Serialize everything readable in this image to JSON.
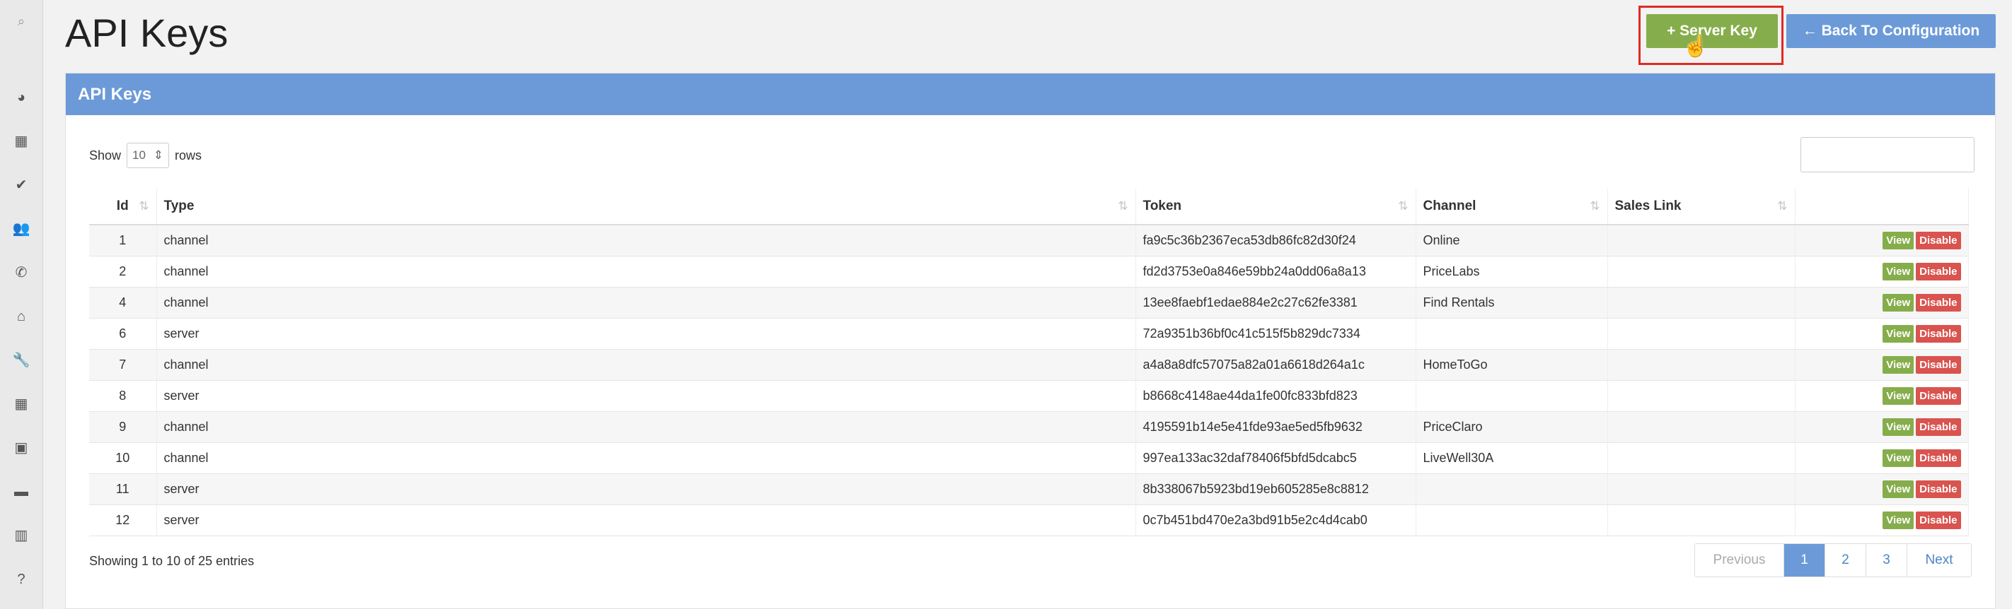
{
  "sidebar": {
    "icons": [
      {
        "name": "search-icon",
        "glyph": "⌕"
      },
      {
        "name": "dashboard-icon",
        "glyph": "◕"
      },
      {
        "name": "calendar-icon",
        "glyph": "▦"
      },
      {
        "name": "check-circle-icon",
        "glyph": "✔"
      },
      {
        "name": "users-icon",
        "glyph": "👥"
      },
      {
        "name": "phone-icon",
        "glyph": "✆"
      },
      {
        "name": "home-icon",
        "glyph": "⌂"
      },
      {
        "name": "wrench-icon",
        "glyph": "🔧"
      },
      {
        "name": "grid-icon",
        "glyph": "▦"
      },
      {
        "name": "money-icon",
        "glyph": "▣"
      },
      {
        "name": "briefcase-icon",
        "glyph": "▬"
      },
      {
        "name": "bar-chart-icon",
        "glyph": "▥"
      },
      {
        "name": "help-icon",
        "glyph": "?"
      }
    ]
  },
  "header": {
    "title": "API Keys",
    "server_key_label": "+ Server Key",
    "back_label": "← Back To Configuration"
  },
  "panel": {
    "heading": "API Keys",
    "show_label": "Show",
    "rows_value": "10",
    "rows_label": "rows",
    "search_value": ""
  },
  "table": {
    "columns": [
      "Id",
      "Type",
      "Token",
      "Channel",
      "Sales Link",
      ""
    ],
    "rows": [
      {
        "id": "1",
        "type": "channel",
        "token": "fa9c5c36b2367eca53db86fc82d30f24",
        "channel": "Online",
        "sales_link": ""
      },
      {
        "id": "2",
        "type": "channel",
        "token": "fd2d3753e0a846e59bb24a0dd06a8a13",
        "channel": "PriceLabs",
        "sales_link": ""
      },
      {
        "id": "4",
        "type": "channel",
        "token": "13ee8faebf1edae884e2c27c62fe3381",
        "channel": "Find Rentals",
        "sales_link": ""
      },
      {
        "id": "6",
        "type": "server",
        "token": "72a9351b36bf0c41c515f5b829dc7334",
        "channel": "",
        "sales_link": ""
      },
      {
        "id": "7",
        "type": "channel",
        "token": "a4a8a8dfc57075a82a01a6618d264a1c",
        "channel": "HomeToGo",
        "sales_link": ""
      },
      {
        "id": "8",
        "type": "server",
        "token": "b8668c4148ae44da1fe00fc833bfd823",
        "channel": "",
        "sales_link": ""
      },
      {
        "id": "9",
        "type": "channel",
        "token": "4195591b14e5e41fde93ae5ed5fb9632",
        "channel": "PriceClaro",
        "sales_link": ""
      },
      {
        "id": "10",
        "type": "channel",
        "token": "997ea133ac32daf78406f5bfd5dcabc5",
        "channel": "LiveWell30A",
        "sales_link": ""
      },
      {
        "id": "11",
        "type": "server",
        "token": "8b338067b5923bd19eb605285e8c8812",
        "channel": "",
        "sales_link": ""
      },
      {
        "id": "12",
        "type": "server",
        "token": "0c7b451bd470e2a3bd91b5e2c4d4cab0",
        "channel": "",
        "sales_link": ""
      }
    ],
    "view_label": "View",
    "disable_label": "Disable"
  },
  "footer": {
    "info": "Showing 1 to 10 of 25 entries",
    "previous": "Previous",
    "pages": [
      "1",
      "2",
      "3"
    ],
    "next": "Next"
  },
  "colors": {
    "accent_blue": "#6c9ad8",
    "green": "#86ad4b",
    "red": "#d9534f",
    "highlight": "#e02a22"
  }
}
